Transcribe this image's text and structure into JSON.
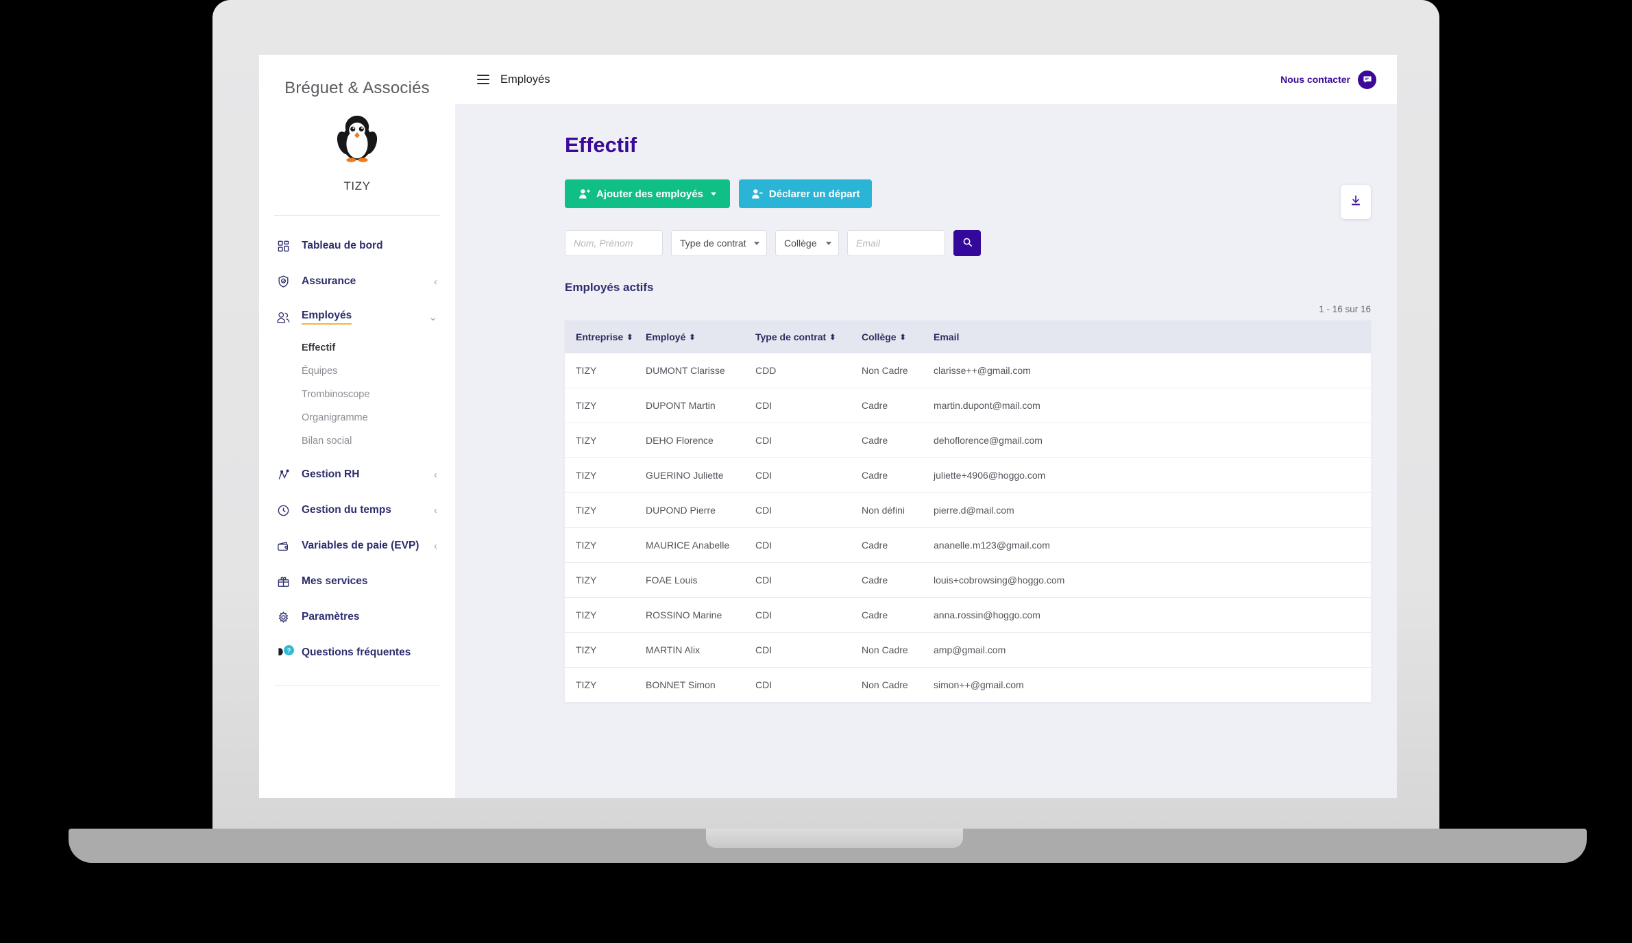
{
  "sidebar": {
    "brand": "Bréguet & Associés",
    "logo_icon": "penguin-logo",
    "tenant": "TIZY",
    "items": [
      {
        "label": "Tableau de bord",
        "icon": "dashboard-grid-icon",
        "chevron": "",
        "active": false
      },
      {
        "label": "Assurance",
        "icon": "shield-check-icon",
        "chevron": "‹",
        "active": false
      },
      {
        "label": "Employés",
        "icon": "people-group-icon",
        "chevron": "⌄",
        "active": true
      },
      {
        "label": "Gestion RH",
        "icon": "chart-line-icon",
        "chevron": "‹",
        "active": false
      },
      {
        "label": "Gestion du temps",
        "icon": "clock-icon",
        "chevron": "‹",
        "active": false
      },
      {
        "label": "Variables de paie (EVP)",
        "icon": "wallet-icon",
        "chevron": "‹",
        "active": false
      },
      {
        "label": "Mes services",
        "icon": "gift-icon",
        "chevron": "",
        "active": false
      },
      {
        "label": "Paramètres",
        "icon": "gear-icon",
        "chevron": "",
        "active": false
      },
      {
        "label": "Questions fréquentes",
        "icon": "help-chat-icon",
        "chevron": "",
        "active": false,
        "badge": "?"
      }
    ],
    "subitems": [
      {
        "label": "Effectif",
        "active": true
      },
      {
        "label": "Équipes",
        "active": false
      },
      {
        "label": "Trombinoscope",
        "active": false
      },
      {
        "label": "Organigramme",
        "active": false
      },
      {
        "label": "Bilan social",
        "active": false
      }
    ]
  },
  "topbar": {
    "menu_icon": "hamburger-menu-icon",
    "title": "Employés",
    "contact_label": "Nous contacter",
    "contact_icon": "chat-bubble-icon"
  },
  "page": {
    "title": "Effectif",
    "download_icon": "download-icon"
  },
  "actions": {
    "add_label": "Ajouter des employés",
    "add_icon": "user-plus-icon",
    "add_caret": "chevron-down-icon",
    "depart_label": "Déclarer un départ",
    "depart_icon": "user-minus-icon"
  },
  "filters": {
    "name_placeholder": "Nom, Prénom",
    "name_value": "",
    "contract_label": "Type de contrat",
    "college_label": "Collège",
    "email_placeholder": "Email",
    "email_value": "",
    "search_icon": "search-icon"
  },
  "table": {
    "heading": "Employés actifs",
    "pagination": "1 - 16 sur 16",
    "columns": [
      {
        "label": "Entreprise",
        "sortable": true
      },
      {
        "label": "Employé",
        "sortable": true
      },
      {
        "label": "Type de contrat",
        "sortable": true
      },
      {
        "label": "Collège",
        "sortable": true
      },
      {
        "label": "Email",
        "sortable": false
      }
    ],
    "rows": [
      {
        "entreprise": "TIZY",
        "employe": "DUMONT Clarisse",
        "contrat": "CDD",
        "college": "Non Cadre",
        "email": "clarisse++@gmail.com"
      },
      {
        "entreprise": "TIZY",
        "employe": "DUPONT Martin",
        "contrat": "CDI",
        "college": "Cadre",
        "email": "martin.dupont@mail.com"
      },
      {
        "entreprise": "TIZY",
        "employe": "DEHO Florence",
        "contrat": "CDI",
        "college": "Cadre",
        "email": "dehoflorence@gmail.com"
      },
      {
        "entreprise": "TIZY",
        "employe": "GUERINO Juliette",
        "contrat": "CDI",
        "college": "Cadre",
        "email": "juliette+4906@hoggo.com"
      },
      {
        "entreprise": "TIZY",
        "employe": "DUPOND Pierre",
        "contrat": "CDI",
        "college": "Non défini",
        "email": "pierre.d@mail.com"
      },
      {
        "entreprise": "TIZY",
        "employe": "MAURICE Anabelle",
        "contrat": "CDI",
        "college": "Cadre",
        "email": "ananelle.m123@gmail.com"
      },
      {
        "entreprise": "TIZY",
        "employe": "FOAE Louis",
        "contrat": "CDI",
        "college": "Cadre",
        "email": "louis+cobrowsing@hoggo.com"
      },
      {
        "entreprise": "TIZY",
        "employe": "ROSSINO Marine",
        "contrat": "CDI",
        "college": "Cadre",
        "email": "anna.rossin@hoggo.com"
      },
      {
        "entreprise": "TIZY",
        "employe": "MARTIN Alix",
        "contrat": "CDI",
        "college": "Non Cadre",
        "email": "amp@gmail.com"
      },
      {
        "entreprise": "TIZY",
        "employe": "BONNET Simon",
        "contrat": "CDI",
        "college": "Non Cadre",
        "email": "simon++@gmail.com"
      }
    ]
  },
  "colors": {
    "brand_purple": "#3b0a96",
    "accent_green": "#10bf86",
    "accent_teal": "#2ab5d6",
    "accent_amber": "#f4b540",
    "link_purple": "#4b2ca8",
    "table_header_bg": "#e4e7f0",
    "page_bg": "#eef0f5"
  }
}
